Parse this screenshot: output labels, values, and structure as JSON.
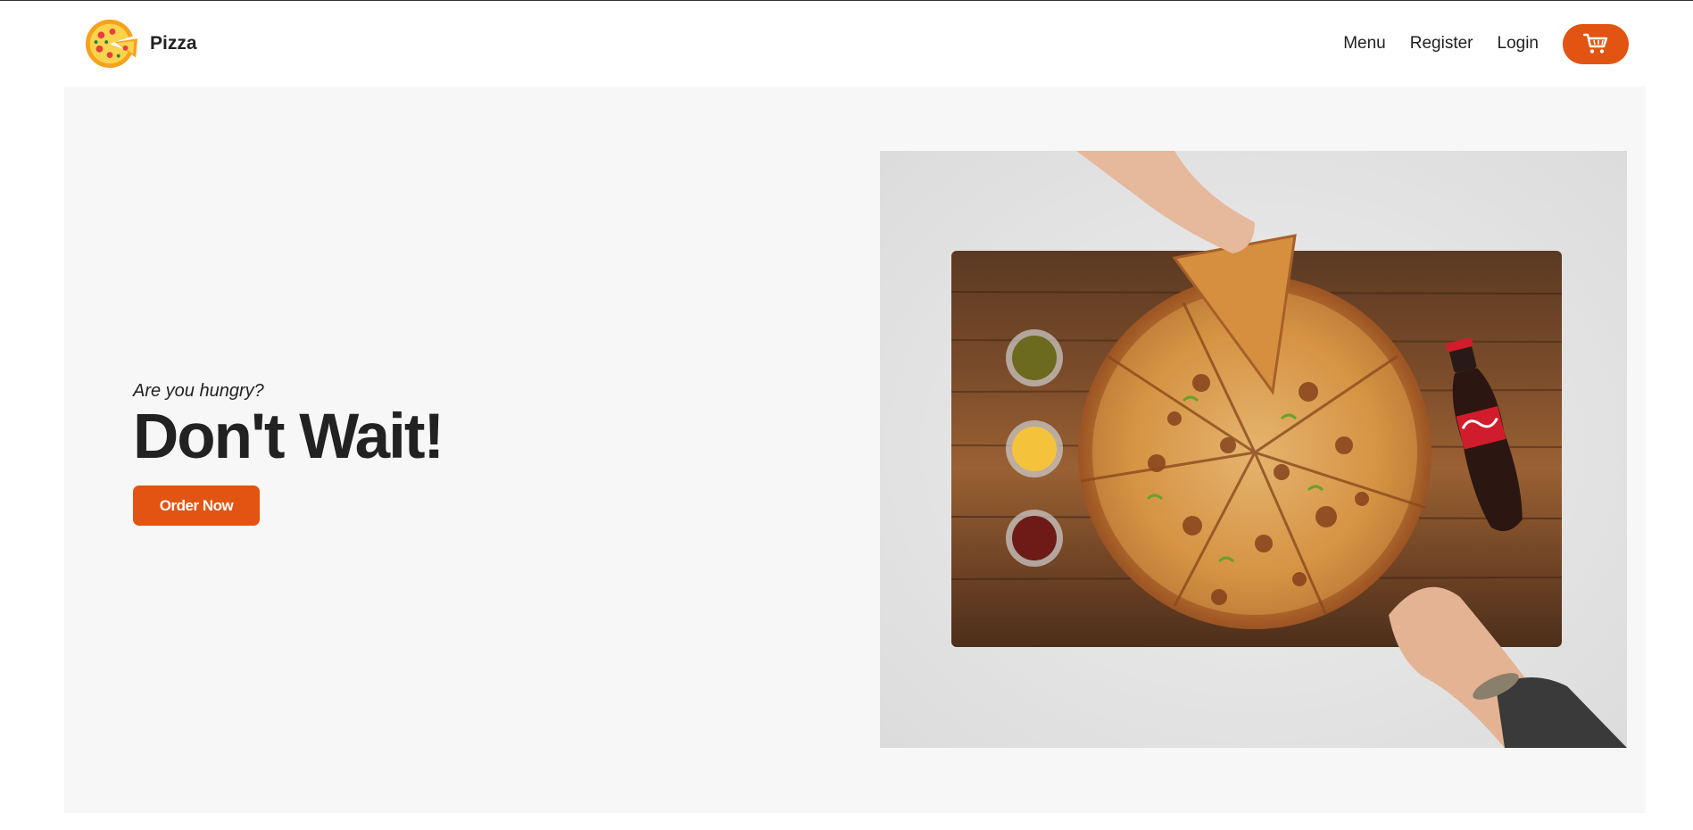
{
  "header": {
    "brand_name": "Pizza",
    "nav": {
      "menu": "Menu",
      "register": "Register",
      "login": "Login"
    },
    "cart_icon": "shopping-cart-icon"
  },
  "hero": {
    "subtitle": "Are you hungry?",
    "headline": "Don't Wait!",
    "cta_label": "Order Now",
    "image_icon": "pizza-table-photo"
  },
  "colors": {
    "accent": "#e25411",
    "hero_background": "#f7f7f7"
  }
}
